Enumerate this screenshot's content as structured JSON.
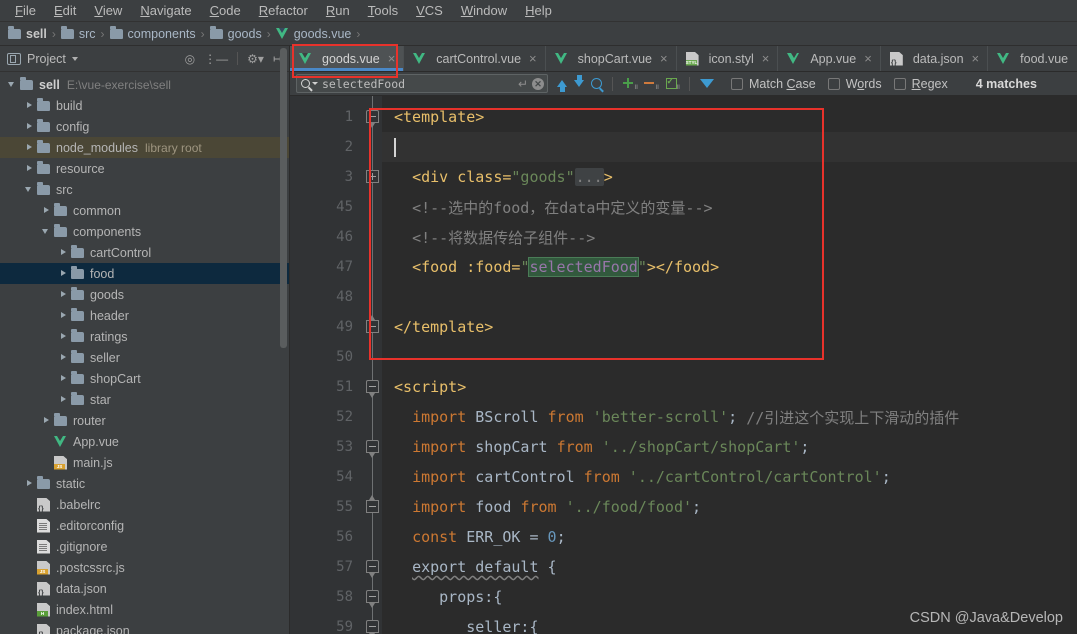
{
  "menubar": {
    "items": [
      {
        "label": "File",
        "mnemonic": "F"
      },
      {
        "label": "Edit",
        "mnemonic": "E"
      },
      {
        "label": "View",
        "mnemonic": "V"
      },
      {
        "label": "Navigate",
        "mnemonic": "N"
      },
      {
        "label": "Code",
        "mnemonic": "C"
      },
      {
        "label": "Refactor",
        "mnemonic": "R"
      },
      {
        "label": "Run",
        "mnemonic": "R"
      },
      {
        "label": "Tools",
        "mnemonic": "T"
      },
      {
        "label": "VCS",
        "mnemonic": "V"
      },
      {
        "label": "Window",
        "mnemonic": "W"
      },
      {
        "label": "Help",
        "mnemonic": "H"
      }
    ]
  },
  "breadcrumb": {
    "items": [
      {
        "label": "sell",
        "icon": "folder-icon",
        "bold": true
      },
      {
        "label": "src",
        "icon": "folder-icon",
        "bold": false
      },
      {
        "label": "components",
        "icon": "folder-icon",
        "bold": false
      },
      {
        "label": "goods",
        "icon": "folder-icon",
        "bold": false
      },
      {
        "label": "goods.vue",
        "icon": "vue-file-icon",
        "bold": false
      }
    ],
    "separator": "›"
  },
  "sidebar": {
    "header": {
      "title": "Project",
      "icons": [
        "project-view-icon",
        "chevron-down-icon",
        "locate-icon",
        "collapse-all-icon",
        "settings-gear-icon",
        "hide-panel-icon"
      ]
    },
    "tree": [
      {
        "label": "sell",
        "suffix": "E:\\vue-exercise\\sell",
        "suffix_kind": "path",
        "indent": 0,
        "arrow": "down",
        "icon": "folder-icon",
        "bold": true,
        "state": "normal"
      },
      {
        "label": "build",
        "indent": 1,
        "arrow": "right",
        "icon": "folder-icon",
        "state": "normal"
      },
      {
        "label": "config",
        "indent": 1,
        "arrow": "right",
        "icon": "folder-icon",
        "state": "normal"
      },
      {
        "label": "node_modules",
        "suffix": "library root",
        "suffix_kind": "lib",
        "indent": 1,
        "arrow": "right",
        "icon": "folder-icon",
        "state": "libroot"
      },
      {
        "label": "resource",
        "indent": 1,
        "arrow": "right",
        "icon": "folder-icon",
        "state": "normal"
      },
      {
        "label": "src",
        "indent": 1,
        "arrow": "down",
        "icon": "folder-icon",
        "state": "normal"
      },
      {
        "label": "common",
        "indent": 2,
        "arrow": "right",
        "icon": "folder-icon",
        "state": "normal"
      },
      {
        "label": "components",
        "indent": 2,
        "arrow": "down",
        "icon": "folder-icon",
        "state": "normal"
      },
      {
        "label": "cartControl",
        "indent": 3,
        "arrow": "right",
        "icon": "folder-icon",
        "state": "normal"
      },
      {
        "label": "food",
        "indent": 3,
        "arrow": "right",
        "icon": "folder-icon",
        "state": "selected"
      },
      {
        "label": "goods",
        "indent": 3,
        "arrow": "right",
        "icon": "folder-icon",
        "state": "normal"
      },
      {
        "label": "header",
        "indent": 3,
        "arrow": "right",
        "icon": "folder-icon",
        "state": "normal"
      },
      {
        "label": "ratings",
        "indent": 3,
        "arrow": "right",
        "icon": "folder-icon",
        "state": "normal"
      },
      {
        "label": "seller",
        "indent": 3,
        "arrow": "right",
        "icon": "folder-icon",
        "state": "normal"
      },
      {
        "label": "shopCart",
        "indent": 3,
        "arrow": "right",
        "icon": "folder-icon",
        "state": "normal"
      },
      {
        "label": "star",
        "indent": 3,
        "arrow": "right",
        "icon": "folder-icon",
        "state": "normal"
      },
      {
        "label": "router",
        "indent": 2,
        "arrow": "right",
        "icon": "folder-icon",
        "state": "normal"
      },
      {
        "label": "App.vue",
        "indent": 2,
        "arrow": "none",
        "icon": "vue-file-icon",
        "state": "normal"
      },
      {
        "label": "main.js",
        "indent": 2,
        "arrow": "none",
        "icon": "js-file-icon",
        "state": "normal"
      },
      {
        "label": "static",
        "indent": 1,
        "arrow": "right",
        "icon": "folder-icon",
        "state": "normal"
      },
      {
        "label": ".babelrc",
        "indent": 1,
        "arrow": "none",
        "icon": "json-file-icon",
        "state": "normal"
      },
      {
        "label": ".editorconfig",
        "indent": 1,
        "arrow": "none",
        "icon": "text-file-icon",
        "state": "normal"
      },
      {
        "label": ".gitignore",
        "indent": 1,
        "arrow": "none",
        "icon": "text-file-icon",
        "state": "normal"
      },
      {
        "label": ".postcssrc.js",
        "indent": 1,
        "arrow": "none",
        "icon": "js-file-icon",
        "state": "normal"
      },
      {
        "label": "data.json",
        "indent": 1,
        "arrow": "none",
        "icon": "json-file-icon",
        "state": "normal"
      },
      {
        "label": "index.html",
        "indent": 1,
        "arrow": "none",
        "icon": "html-file-icon",
        "state": "normal"
      },
      {
        "label": "package.json",
        "indent": 1,
        "arrow": "none",
        "icon": "json-file-icon",
        "state": "normal"
      }
    ]
  },
  "tabs": [
    {
      "label": "goods.vue",
      "icon": "vue-file-icon",
      "active": true,
      "close": "×"
    },
    {
      "label": "cartControl.vue",
      "icon": "vue-file-icon",
      "active": false,
      "close": "×"
    },
    {
      "label": "shopCart.vue",
      "icon": "vue-file-icon",
      "active": false,
      "close": "×"
    },
    {
      "label": "icon.styl",
      "icon": "styl-file-icon",
      "active": false,
      "close": "×"
    },
    {
      "label": "App.vue",
      "icon": "vue-file-icon",
      "active": false,
      "close": "×"
    },
    {
      "label": "data.json",
      "icon": "json-file-icon",
      "active": false,
      "close": "×"
    },
    {
      "label": "food.vue",
      "icon": "vue-file-icon",
      "active": false,
      "close": "×"
    }
  ],
  "search": {
    "value": "selectedFood",
    "placeholder": "Search",
    "match_case_label": "Match Case",
    "match_case_mnemonic": "C",
    "words_label": "Words",
    "words_mnemonic": "o",
    "regex_label": "Regex",
    "regex_mnemonic": "R",
    "match_case_checked": false,
    "words_checked": false,
    "regex_checked": false,
    "matches_text": "4 matches",
    "buttons": [
      "prev-match-icon",
      "next-match-icon",
      "select-all-occurrences-icon",
      "add-line-icon",
      "remove-line-icon",
      "toggle-line-icon",
      "filter-icon"
    ]
  },
  "editor": {
    "lines": [
      {
        "num": "1",
        "fold": "start-collapse",
        "current": false
      },
      {
        "num": "2",
        "fold": "none",
        "current": true
      },
      {
        "num": "3",
        "fold": "plus",
        "current": false
      },
      {
        "num": "45",
        "fold": "none",
        "current": false
      },
      {
        "num": "46",
        "fold": "none",
        "current": false
      },
      {
        "num": "47",
        "fold": "none",
        "current": false
      },
      {
        "num": "48",
        "fold": "none",
        "current": false
      },
      {
        "num": "49",
        "fold": "end",
        "current": false
      },
      {
        "num": "50",
        "fold": "none",
        "current": false
      },
      {
        "num": "51",
        "fold": "start-collapse",
        "current": false
      },
      {
        "num": "52",
        "fold": "none",
        "current": false
      },
      {
        "num": "53",
        "fold": "start-collapse",
        "current": false
      },
      {
        "num": "54",
        "fold": "none",
        "current": false
      },
      {
        "num": "55",
        "fold": "end",
        "current": false
      },
      {
        "num": "56",
        "fold": "none",
        "current": false
      },
      {
        "num": "57",
        "fold": "start-collapse",
        "current": false
      },
      {
        "num": "58",
        "fold": "start-collapse",
        "current": false
      },
      {
        "num": "59",
        "fold": "start-collapse",
        "current": false
      }
    ],
    "code": {
      "l1": "<template>",
      "l2": "",
      "l3_a": "<div class=",
      "l3_str": "\"goods\"",
      "l3_ellipsis": "...",
      "l3_end": ">",
      "l45": "<!--选中的food，在data中定义的变量-->",
      "l46": "<!--将数据传给子组件-->",
      "l47_a": "<food :food=",
      "l47_q1": "\"",
      "l47_hl": "selectedFood",
      "l47_q2": "\"",
      "l47_b": "></food>",
      "l49": "</template>",
      "l51": "<script>",
      "l52_kw1": "import",
      "l52_id": " BScroll ",
      "l52_kw2": "from",
      "l52_str": " 'better-scroll'",
      "l52_semi": ";",
      "l52_cmt": " //引进这个实现上下滑动的插件",
      "l53_kw1": "import",
      "l53_id": " shopCart ",
      "l53_kw2": "from",
      "l53_str": " '../shopCart/shopCart'",
      "l53_semi": ";",
      "l54_kw1": "import",
      "l54_id": " cartControl ",
      "l54_kw2": "from",
      "l54_str": " '../cartControl/cartControl'",
      "l54_semi": ";",
      "l55_kw1": "import",
      "l55_id": " food ",
      "l55_kw2": "from",
      "l55_str": " '../food/food'",
      "l55_semi": ";",
      "l56_kw": "const",
      "l56_id": " ERR_OK ",
      "l56_eq": "= ",
      "l56_num": "0",
      "l56_semi": ";",
      "l57_kw": "export default",
      "l57_brace": " {",
      "l58": "props:{",
      "l59": "seller:{"
    }
  },
  "watermark": "CSDN @Java&Develop",
  "colors": {
    "accent_blue": "#4a88c7",
    "annotation_red": "#e8322b",
    "highlight_green": "#32593d",
    "selection_blue": "#0d293e",
    "vue_green": "#41b883"
  }
}
